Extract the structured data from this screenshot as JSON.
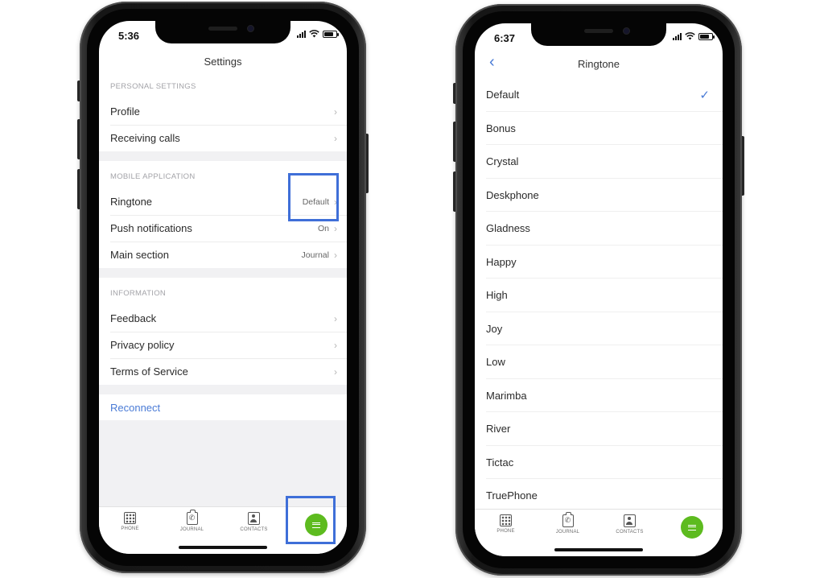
{
  "left_phone": {
    "status_time": "5:36",
    "title": "Settings",
    "sections": [
      {
        "header": "PERSONAL SETTINGS",
        "rows": [
          {
            "label": "Profile",
            "value": ""
          },
          {
            "label": "Receiving calls",
            "value": ""
          }
        ]
      },
      {
        "header": "MOBILE APPLICATION",
        "rows": [
          {
            "label": "Ringtone",
            "value": "Default"
          },
          {
            "label": "Push notifications",
            "value": "On"
          },
          {
            "label": "Main section",
            "value": "Journal"
          }
        ]
      },
      {
        "header": "INFORMATION",
        "rows": [
          {
            "label": "Feedback",
            "value": ""
          },
          {
            "label": "Privacy policy",
            "value": ""
          },
          {
            "label": "Terms of Service",
            "value": ""
          }
        ]
      }
    ],
    "reconnect_label": "Reconnect"
  },
  "right_phone": {
    "status_time": "6:37",
    "title": "Ringtone",
    "selected": "Default",
    "ringtones": [
      "Default",
      "Bonus",
      "Crystal",
      "Deskphone",
      "Gladness",
      "Happy",
      "High",
      "Joy",
      "Low",
      "Marimba",
      "River",
      "Tictac",
      "TruePhone"
    ]
  },
  "tabbar": {
    "phone": "PHONE",
    "journal": "JOURNAL",
    "contacts": "CONTACTS"
  },
  "icons": {
    "chevron": "chevron-right-icon",
    "check": "checkmark-icon",
    "back": "chevron-left-icon",
    "menu": "hamburger-menu-icon"
  },
  "colors": {
    "accent": "#4a7bd6",
    "menu_button": "#5dbb1f",
    "highlight": "#3f6fd8"
  }
}
